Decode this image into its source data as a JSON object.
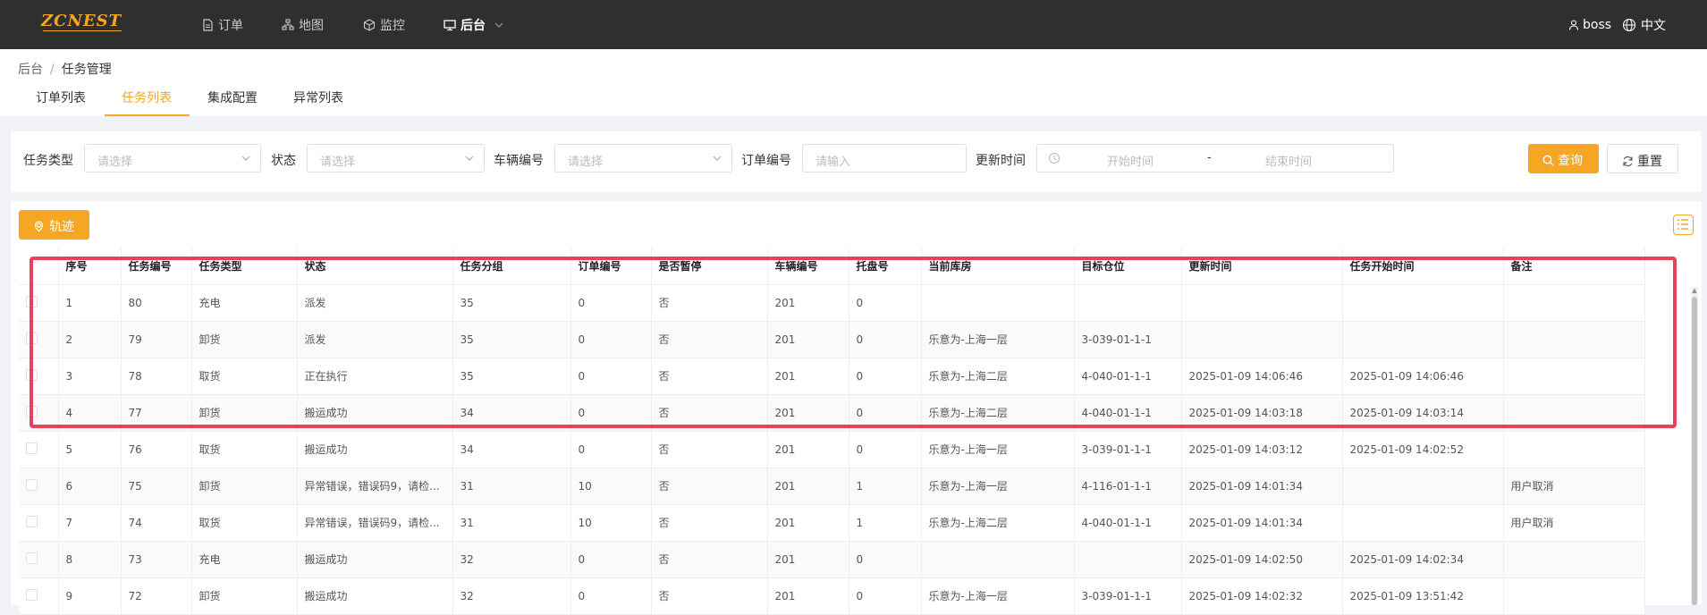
{
  "header": {
    "logo": "ZCNEST",
    "nav": [
      {
        "label": "订单",
        "icon": "document-icon"
      },
      {
        "label": "地图",
        "icon": "sitemap-icon"
      },
      {
        "label": "监控",
        "icon": "cube-icon"
      },
      {
        "label": "后台",
        "icon": "monitor-icon",
        "active": true
      }
    ],
    "user": "boss",
    "language": "中文"
  },
  "breadcrumb": {
    "root": "后台",
    "sep": "/",
    "current": "任务管理"
  },
  "tabs": [
    {
      "label": "订单列表"
    },
    {
      "label": "任务列表",
      "active": true
    },
    {
      "label": "集成配置"
    },
    {
      "label": "异常列表"
    }
  ],
  "filters": {
    "task_type": {
      "label": "任务类型",
      "placeholder": "请选择"
    },
    "status": {
      "label": "状态",
      "placeholder": "请选择"
    },
    "vehicle_no": {
      "label": "车辆编号",
      "placeholder": "请选择"
    },
    "order_no": {
      "label": "订单编号",
      "placeholder": "请输入"
    },
    "update_time": {
      "label": "更新时间",
      "start": "开始时间",
      "sep": "-",
      "end": "结束时间"
    },
    "query_label": "查询",
    "reset_label": "重置"
  },
  "toolbar": {
    "track_label": "轨迹"
  },
  "table": {
    "headers": [
      "序号",
      "任务编号",
      "任务类型",
      "状态",
      "任务分组",
      "订单编号",
      "是否暂停",
      "车辆编号",
      "托盘号",
      "当前库房",
      "目标仓位",
      "更新时间",
      "任务开始时间",
      "备注"
    ],
    "rows": [
      [
        "1",
        "80",
        "充电",
        "派发",
        "35",
        "0",
        "否",
        "201",
        "0",
        "",
        "",
        "",
        "",
        ""
      ],
      [
        "2",
        "79",
        "卸货",
        "派发",
        "35",
        "0",
        "否",
        "201",
        "0",
        "乐意为-上海一层",
        "3-039-01-1-1",
        "",
        "",
        ""
      ],
      [
        "3",
        "78",
        "取货",
        "正在执行",
        "35",
        "0",
        "否",
        "201",
        "0",
        "乐意为-上海二层",
        "4-040-01-1-1",
        "2025-01-09 14:06:46",
        "2025-01-09 14:06:46",
        ""
      ],
      [
        "4",
        "77",
        "卸货",
        "搬运成功",
        "34",
        "0",
        "否",
        "201",
        "0",
        "乐意为-上海二层",
        "4-040-01-1-1",
        "2025-01-09 14:03:18",
        "2025-01-09 14:03:14",
        ""
      ],
      [
        "5",
        "76",
        "取货",
        "搬运成功",
        "34",
        "0",
        "否",
        "201",
        "0",
        "乐意为-上海一层",
        "3-039-01-1-1",
        "2025-01-09 14:03:12",
        "2025-01-09 14:02:52",
        ""
      ],
      [
        "6",
        "75",
        "卸货",
        "异常错误，错误码9，请检...",
        "31",
        "10",
        "否",
        "201",
        "1",
        "乐意为-上海一层",
        "4-116-01-1-1",
        "2025-01-09 14:01:34",
        "",
        "用户取消"
      ],
      [
        "7",
        "74",
        "取货",
        "异常错误，错误码9，请检...",
        "31",
        "10",
        "否",
        "201",
        "1",
        "乐意为-上海二层",
        "4-040-01-1-1",
        "2025-01-09 14:01:34",
        "",
        "用户取消"
      ],
      [
        "8",
        "73",
        "充电",
        "搬运成功",
        "32",
        "0",
        "否",
        "201",
        "0",
        "",
        "",
        "2025-01-09 14:02:50",
        "2025-01-09 14:02:34",
        ""
      ],
      [
        "9",
        "72",
        "卸货",
        "搬运成功",
        "32",
        "0",
        "否",
        "201",
        "0",
        "乐意为-上海一层",
        "3-039-01-1-1",
        "2025-01-09 14:02:32",
        "2025-01-09 13:51:42",
        ""
      ]
    ]
  },
  "colors": {
    "accent": "#f5a623",
    "header_bg": "#2f2f2f",
    "highlight": "#e8415a"
  }
}
